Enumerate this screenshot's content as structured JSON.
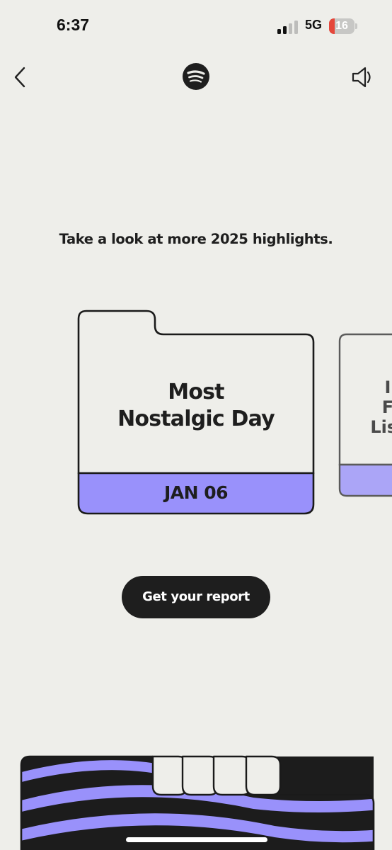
{
  "status_bar": {
    "time": "6:37",
    "network": "5G",
    "battery": "16"
  },
  "nav": {
    "back_icon": "chevron-left-icon",
    "logo_icon": "spotify-logo-icon",
    "sound_icon": "speaker-icon"
  },
  "main": {
    "heading": "Take a look at more 2025 highlights.",
    "card": {
      "title": "Most\nNostalgic Day",
      "date": "JAN 06",
      "accent_color": "#9991fb"
    },
    "next_card": {
      "partial_title": "I\nF\nList"
    },
    "cta_label": "Get your report"
  },
  "colors": {
    "background": "#eeeeea",
    "accent": "#9991fb",
    "dark": "#1e1e1e"
  }
}
